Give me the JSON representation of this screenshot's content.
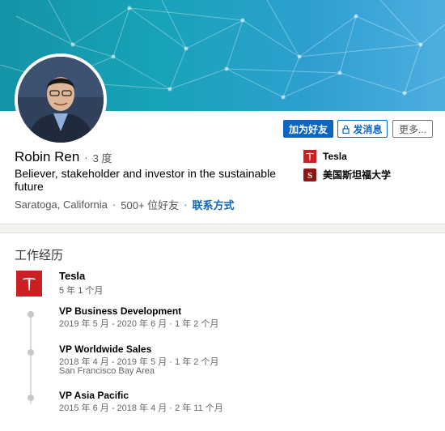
{
  "profile": {
    "name": "Robin Ren",
    "degree": "3 度",
    "headline": "Believer, stakeholder and investor in the sustainable future",
    "location": "Saratoga, California",
    "connections": "500+ 位好友",
    "contact_info": "联系方式"
  },
  "actions": {
    "connect": "加为好友",
    "message": "发消息",
    "more": "更多..."
  },
  "organizations": [
    {
      "name": "Tesla",
      "icon": "tesla-logo"
    },
    {
      "name": "美国斯坦福大学",
      "icon": "stanford-logo"
    }
  ],
  "experience": {
    "section_title": "工作经历",
    "company": "Tesla",
    "company_duration": "5 年 1 个月",
    "roles": [
      {
        "title": "VP Business Development",
        "dates": "2019 年 5 月 - 2020 年 6 月 · 1 年 2 个月",
        "location": ""
      },
      {
        "title": "VP Worldwide Sales",
        "dates": "2018 年 4 月 - 2019 年 5 月 · 1 年 2 个月",
        "location": "San Francisco Bay Area"
      },
      {
        "title": "VP Asia Pacific",
        "dates": "2015 年 6 月 - 2018 年 4 月 · 2 年 11 个月",
        "location": ""
      }
    ]
  },
  "colors": {
    "brand_blue": "#0a66c2",
    "tesla_red": "#cc1f24",
    "stanford_red": "#8c1515"
  }
}
